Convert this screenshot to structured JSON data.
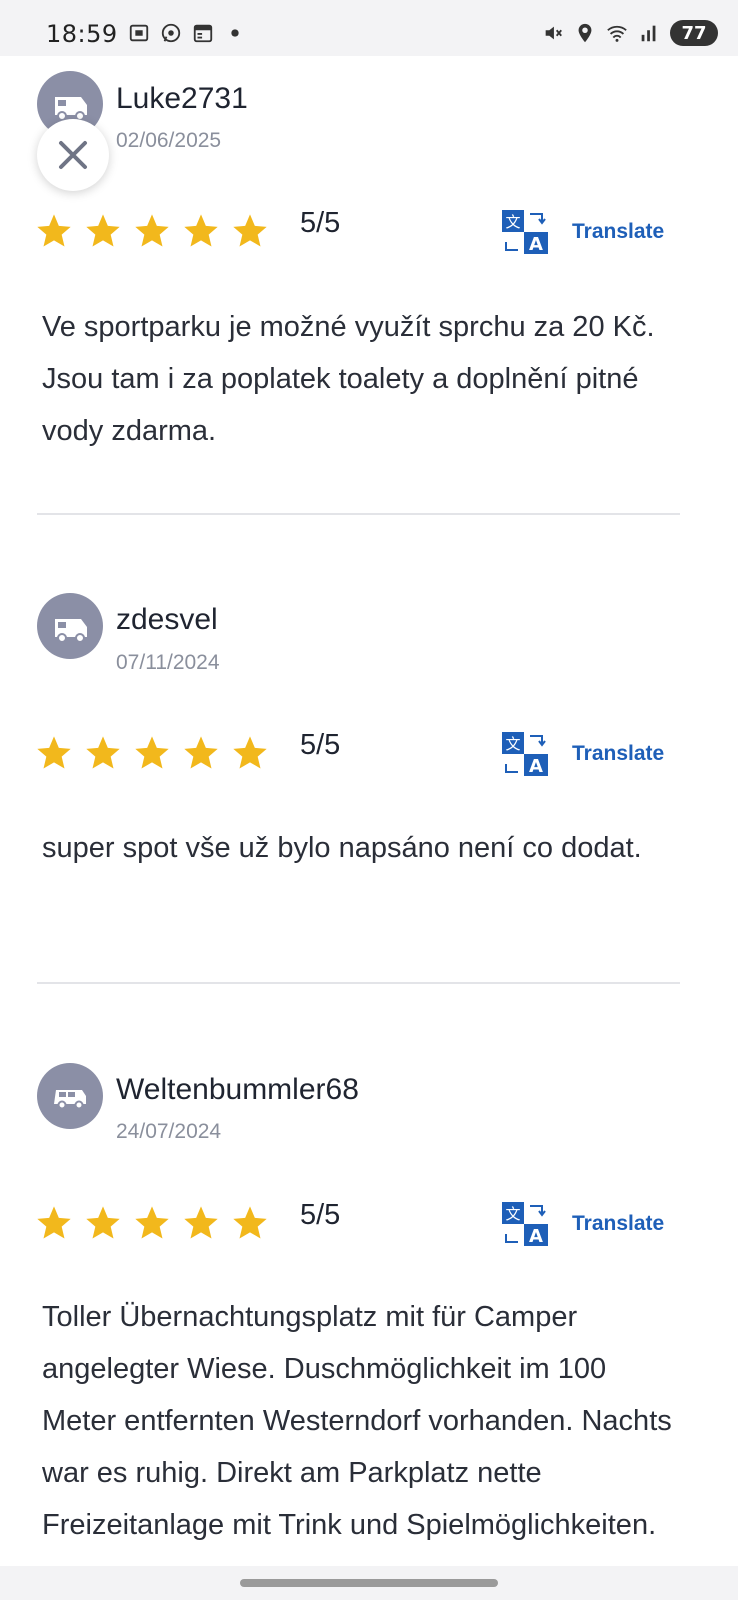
{
  "status_bar": {
    "time": "18:59",
    "battery": "77",
    "left_icons": [
      "screenshot-icon",
      "whatsapp-icon",
      "calendar-icon",
      "dot-icon"
    ],
    "right_icons": [
      "mute-icon",
      "location-icon",
      "wifi-icon",
      "signal-icon"
    ]
  },
  "close_button": {
    "icon": "close-icon"
  },
  "reviews": [
    {
      "username": "Luke2731",
      "date": "02/06/2025",
      "avatar_icon": "camper-icon",
      "stars": 5,
      "rating": "5/5",
      "translate_label": "Translate",
      "text": "Ve sportparku je možné využít sprchu za 20 Kč. Jsou tam i za poplatek toalety a doplnění pitné vody zdarma."
    },
    {
      "username": "zdesvel",
      "date": "07/11/2024",
      "avatar_icon": "camper-icon",
      "stars": 5,
      "rating": "5/5",
      "translate_label": "Translate",
      "text": "super spot vše už bylo napsáno není co dodat."
    },
    {
      "username": "Weltenbummler68",
      "date": "24/07/2024",
      "avatar_icon": "van-icon",
      "stars": 5,
      "rating": "5/5",
      "translate_label": "Translate",
      "text": "Toller Übernachtungsplatz mit für Camper angelegter Wiese. Duschmöglichkeit im 100 Meter entfernten Westerndorf vorhanden. Nachts war es ruhig. Direkt am Parkplatz nette Freizeitanlage mit Trink und Spielmöglichkeiten."
    }
  ],
  "colors": {
    "star": "#f2b81c",
    "translate": "#1e5fb8",
    "avatar_bg": "#8b8fa6",
    "divider": "#e3e4e8"
  }
}
